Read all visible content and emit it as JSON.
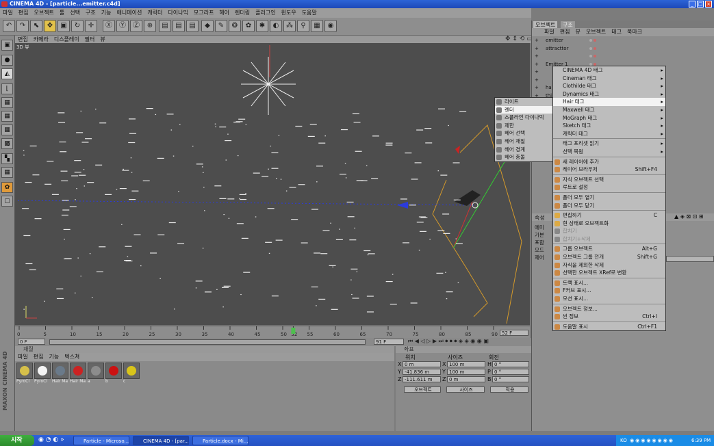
{
  "window": {
    "title": "CINEMA 4D - [particle...emitter.c4d]"
  },
  "menubar": [
    "파일",
    "편집",
    "오브젝트",
    "툴",
    "선택",
    "구조",
    "기능",
    "애니메이션",
    "캐릭터",
    "다이나믹",
    "모그라프",
    "헤어",
    "렌더링",
    "플러그인",
    "윈도우",
    "도움말"
  ],
  "viewport": {
    "menu": [
      "편집",
      "카메라",
      "디스플레이",
      "필터",
      "뷰"
    ],
    "label": "3D 뷰"
  },
  "timeline": {
    "ticks": [
      "0",
      "5",
      "10",
      "15",
      "20",
      "25",
      "30",
      "35",
      "40",
      "45",
      "50",
      "52",
      "55",
      "60",
      "65",
      "70",
      "75",
      "80",
      "85",
      "90"
    ],
    "current_frame": "52 F",
    "start_field": "0 F",
    "end_field": "91 F"
  },
  "materials": {
    "header": "재질",
    "menu": [
      "파일",
      "편집",
      "기능",
      "텍스쳐"
    ],
    "items": [
      {
        "label": "PyroCl",
        "color": "#d6c04a"
      },
      {
        "label": "PyroCl",
        "color": "#f4f4f4"
      },
      {
        "label": "Hair Ma",
        "color": "#6a7a8a"
      },
      {
        "label": "Hair Ma",
        "color": "#cc2222"
      },
      {
        "label": "a",
        "color": "#8c8c8c"
      },
      {
        "label": "b",
        "color": "#cc1111"
      },
      {
        "label": "c",
        "color": "#d8c41a"
      }
    ]
  },
  "coords": {
    "header": "좌표",
    "columns": [
      "위치",
      "사이즈",
      "회전"
    ],
    "rows": [
      {
        "axis": "X",
        "pos": "0 m",
        "saxis": "X",
        "size": "100 m",
        "raxis": "H",
        "rot": "0 °"
      },
      {
        "axis": "Y",
        "pos": "-41.836 m",
        "saxis": "Y",
        "size": "100 m",
        "raxis": "P",
        "rot": "0 °"
      },
      {
        "axis": "Z",
        "pos": "-111.611 m",
        "saxis": "Z",
        "size": "0 m",
        "raxis": "B",
        "rot": "0 °"
      }
    ],
    "buttons": [
      "오브젝트",
      "사이즈",
      "적용"
    ]
  },
  "objects": {
    "tabs": [
      "오브젝트",
      "구조"
    ],
    "menu": [
      "파일",
      "편집",
      "뷰",
      "오브젝트",
      "태그",
      "북마크"
    ],
    "tree": [
      "emitter",
      "attracttor",
      "",
      "Emitter 1",
      "",
      "",
      "ha",
      "thi"
    ]
  },
  "attributes": {
    "tab": "속성",
    "mode": "모드",
    "items": [
      "에미",
      "기본",
      "포함",
      "모드",
      "제어"
    ]
  },
  "context_menu": {
    "items": [
      {
        "label": "CINEMA 4D 태그",
        "submenu": true,
        "color": ""
      },
      {
        "label": "Cineman 태그",
        "submenu": true,
        "color": ""
      },
      {
        "label": "Clothilde 태그",
        "submenu": true,
        "color": ""
      },
      {
        "label": "Dynamics 태그",
        "submenu": true,
        "color": ""
      },
      {
        "label": "Hair 태그",
        "submenu": true,
        "color": "",
        "highlight": true
      },
      {
        "label": "Maxwell 태그",
        "submenu": true,
        "color": ""
      },
      {
        "label": "MoGraph 태그",
        "submenu": true,
        "color": ""
      },
      {
        "label": "Sketch 태그",
        "submenu": true,
        "color": ""
      },
      {
        "label": "캐릭터 태그",
        "submenu": true,
        "color": ""
      },
      {
        "sep": true
      },
      {
        "label": "태그 프리셋 읽기",
        "submenu": true,
        "color": ""
      },
      {
        "label": "선택 복원",
        "submenu": true,
        "color": ""
      },
      {
        "sep": true
      },
      {
        "label": "새 레이어에 추가",
        "color": "#c84"
      },
      {
        "label": "레이어 브라우저",
        "shortcut": "Shift+F4",
        "color": "#c84"
      },
      {
        "sep": true
      },
      {
        "label": "자식 오브젝트 선택",
        "color": "#c84"
      },
      {
        "label": "루트로 설정",
        "color": "#c84"
      },
      {
        "sep": true
      },
      {
        "label": "폴더 모두 열기",
        "color": "#c84"
      },
      {
        "label": "폴더 모두 닫기",
        "color": "#c84"
      },
      {
        "sep": true
      },
      {
        "label": "편집하기",
        "shortcut": "C",
        "color": "#da4"
      },
      {
        "label": "현 상태로 오브젝트화",
        "color": "#da4"
      },
      {
        "label": "합치기",
        "disabled": true,
        "color": "#888"
      },
      {
        "label": "합치기+삭제",
        "disabled": true,
        "color": "#888"
      },
      {
        "sep": true
      },
      {
        "label": "그룹 오브젝트",
        "shortcut": "Alt+G",
        "color": "#c84"
      },
      {
        "label": "오브젝트 그룹 전개",
        "shortcut": "Shift+G",
        "color": "#c84"
      },
      {
        "label": "자식을 제외한 삭제",
        "color": "#c84"
      },
      {
        "label": "선택한 오브젝트 XRef로 변환",
        "color": "#c84"
      },
      {
        "sep": true
      },
      {
        "label": "트랙 표시...",
        "color": "#c84"
      },
      {
        "label": "F커브 표시...",
        "color": "#c84"
      },
      {
        "label": "모션 표시...",
        "color": "#c84"
      },
      {
        "sep": true
      },
      {
        "label": "오브젝트 정보...",
        "color": "#c84"
      },
      {
        "label": "씬 정보",
        "shortcut": "Ctrl+I",
        "color": "#c84"
      },
      {
        "sep": true
      },
      {
        "label": "도움말 표시",
        "shortcut": "Ctrl+F1",
        "color": "#c84"
      }
    ]
  },
  "hair_submenu": {
    "items": [
      {
        "label": "라이트"
      },
      {
        "label": "렌더",
        "highlight": true
      },
      {
        "label": "스플라인 다이나믹"
      },
      {
        "label": "제한"
      },
      {
        "label": "헤어 선택"
      },
      {
        "label": "헤어 재질"
      },
      {
        "label": "헤어 경계"
      },
      {
        "label": "헤어 충돌"
      }
    ]
  },
  "taskbar": {
    "start": "시작",
    "tasks": [
      "Particle - Microso...",
      "CINEMA 4D - [par...",
      "Particle.docx - Mi..."
    ],
    "lang": "KO",
    "time": "6:39 PM"
  },
  "brand": "MAXON CINEMA 4D"
}
